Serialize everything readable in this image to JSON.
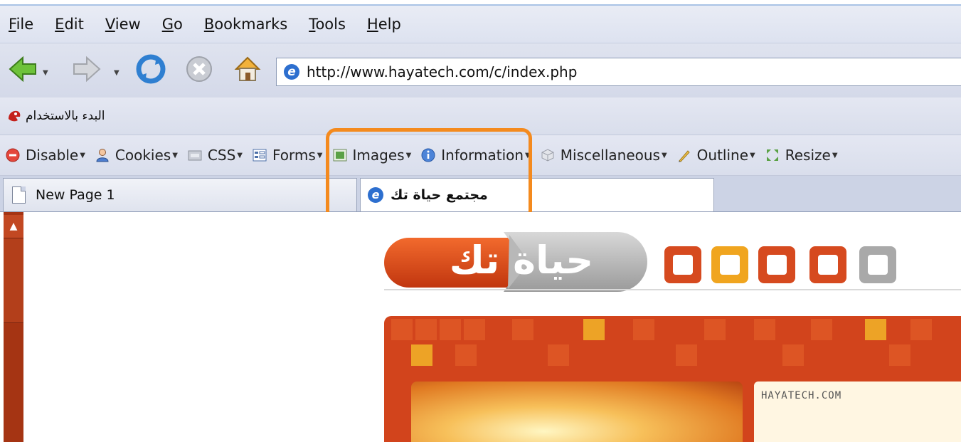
{
  "menu": {
    "items": [
      {
        "prefix": "",
        "accel": "F",
        "rest": "ile"
      },
      {
        "prefix": "",
        "accel": "E",
        "rest": "dit"
      },
      {
        "prefix": "",
        "accel": "V",
        "rest": "iew"
      },
      {
        "prefix": "",
        "accel": "G",
        "rest": "o"
      },
      {
        "prefix": "",
        "accel": "B",
        "rest": "ookmarks"
      },
      {
        "prefix": "",
        "accel": "T",
        "rest": "ools"
      },
      {
        "prefix": "",
        "accel": "H",
        "rest": "elp"
      }
    ]
  },
  "navigation": {
    "back_icon": "back-arrow-icon",
    "forward_icon": "forward-arrow-icon",
    "reload_icon": "reload-icon",
    "stop_icon": "stop-icon",
    "home_icon": "home-icon",
    "url": "http://www.hayatech.com/c/index.php"
  },
  "bookmarks": {
    "items": [
      {
        "label": "البدء بالاستخدام",
        "icon": "firefox-red-icon"
      }
    ]
  },
  "devtoolbar": {
    "items": [
      {
        "label": "Disable",
        "icon": "disable-icon"
      },
      {
        "label": "Cookies",
        "icon": "cookies-icon"
      },
      {
        "label": "CSS",
        "icon": "css-icon"
      },
      {
        "label": "Forms",
        "icon": "forms-icon"
      },
      {
        "label": "Images",
        "icon": "images-icon"
      },
      {
        "label": "Information",
        "icon": "information-icon"
      },
      {
        "label": "Miscellaneous",
        "icon": "miscellaneous-icon"
      },
      {
        "label": "Outline",
        "icon": "outline-icon"
      },
      {
        "label": "Resize",
        "icon": "resize-icon"
      }
    ]
  },
  "tabs": [
    {
      "label": "New Page 1",
      "icon": "document-icon",
      "active": false
    },
    {
      "label": "مجتمع حياة تك",
      "icon": "ie-icon",
      "active": true
    }
  ],
  "page": {
    "logo_text": "حياة تك",
    "banner_text": "HAYATECH.COM",
    "colors": {
      "brand_orange": "#d2441c",
      "brand_yellow": "#eda326",
      "highlight": "#f48a1e"
    }
  }
}
